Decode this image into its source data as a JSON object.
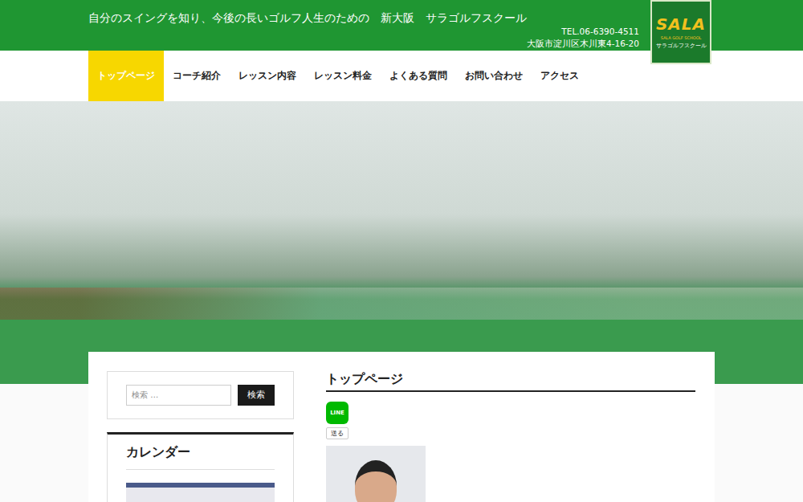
{
  "header": {
    "tagline": "自分のスイングを知り、今後の長いゴルフ人生のための　新大阪　サラゴルフスクール",
    "tel": "TEL.06-6390-4511",
    "address": "大阪市淀川区木川東4-16-20",
    "logo": {
      "mark": "SALA",
      "sub": "SALA GOLF SCHOOL",
      "name": "サラゴルフスクール"
    }
  },
  "nav": [
    {
      "label": "トップページ",
      "selected": true
    },
    {
      "label": "コーチ紹介",
      "selected": false
    },
    {
      "label": "レッスン内容",
      "selected": false
    },
    {
      "label": "レッスン料金",
      "selected": false
    },
    {
      "label": "よくある質問",
      "selected": false
    },
    {
      "label": "お問い合わせ",
      "selected": false
    },
    {
      "label": "アクセス",
      "selected": false
    }
  ],
  "search": {
    "placeholder": "検索 …",
    "button": "検索"
  },
  "calendar": {
    "title": "カレンダー"
  },
  "page": {
    "title": "トップページ",
    "share": {
      "icon": "LINE",
      "label": "送る"
    }
  }
}
